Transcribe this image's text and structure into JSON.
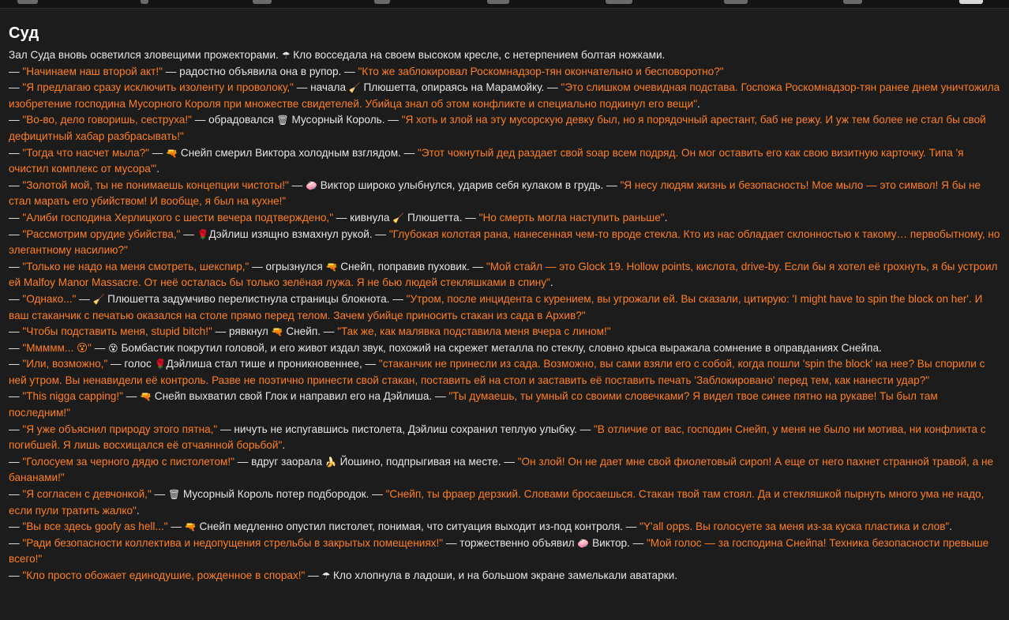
{
  "app": {
    "page_title": "Суд"
  },
  "nav": {
    "icons": [
      "home-icon",
      "pin-icon",
      "people-icon",
      "box-icon",
      "key-icon",
      "map-icon",
      "book-icon",
      "circle-icon",
      "window-icon"
    ]
  },
  "colors": {
    "background": "#1c1c1c",
    "text": "#e6e6e6",
    "quote": "#ff7f1e"
  },
  "story": [
    [
      {
        "t": "Зал Суда вновь осветился зловещими прожекторами. "
      },
      {
        "e": "☂"
      },
      {
        "t": " Кло восседала на своем высоком кресле, с нетерпением болтая ножками."
      }
    ],
    [
      {
        "t": "— "
      },
      {
        "q": "\"Начинаем наш второй акт!\""
      },
      {
        "t": " — радостно объявила она в рупор. — "
      },
      {
        "q": "\"Кто же заблокировал Роскомнадзор-тян окончательно и бесповоротно?\""
      }
    ],
    [
      {
        "t": "— "
      },
      {
        "q": "\"Я предлагаю сразу исключить изоленту и проволоку,\""
      },
      {
        "t": " — начала "
      },
      {
        "e": "🧹"
      },
      {
        "t": " Плюшетта, опираясь на Марамойку. — "
      },
      {
        "q": "\"Это слишком очевидная подстава. Госпожа Роскомнадзор-тян ранее днем уничтожила изобретение господина Мусорного Короля при множестве свидетелей. Убийца знал об этом конфликте и специально подкинул его вещи\""
      },
      {
        "t": "."
      }
    ],
    [
      {
        "t": "— "
      },
      {
        "q": "\"Во-во, дело говоришь, сеструха!\""
      },
      {
        "t": " — обрадовался "
      },
      {
        "e": "🗑"
      },
      {
        "t": " Мусорный Король. — "
      },
      {
        "q": "\"Я хоть и злой на эту мусорскую девку был, но я порядочный арестант, баб не режу. И уж тем более не стал бы свой дефицитный хабар разбрасывать!\""
      }
    ],
    [
      {
        "t": "— "
      },
      {
        "q": "\"Тогда что насчет мыла?\""
      },
      {
        "t": " — "
      },
      {
        "e": "🔫"
      },
      {
        "t": " Снейп смерил Виктора холодным взглядом. — "
      },
      {
        "q": "\"Этот чокнутый дед раздает свой soap всем подряд. Он мог оставить его как свою визитную карточку. Типа 'я очистил комплекс от мусора'\""
      },
      {
        "t": "."
      }
    ],
    [
      {
        "t": "— "
      },
      {
        "q": "\"Золотой мой, ты не понимаешь концепции чистоты!\""
      },
      {
        "t": " — "
      },
      {
        "e": "🧼"
      },
      {
        "t": " Виктор широко улыбнулся, ударив себя кулаком в грудь. — "
      },
      {
        "q": "\"Я несу людям жизнь и безопасность! Мое мыло — это символ! Я бы не стал марать его убийством! И вообще, я был на кухне!\""
      }
    ],
    [
      {
        "t": "— "
      },
      {
        "q": "\"Алиби господина Херлицкого с шести вечера подтверждено,\""
      },
      {
        "t": " — кивнула "
      },
      {
        "e": "🧹"
      },
      {
        "t": " Плюшетта. — "
      },
      {
        "q": "\"Но смерть могла наступить раньше\""
      },
      {
        "t": "."
      }
    ],
    [
      {
        "t": "— "
      },
      {
        "q": "\"Рассмотрим орудие убийства,\""
      },
      {
        "t": " — "
      },
      {
        "e": "🌹"
      },
      {
        "t": "Дэйлиш изящно взмахнул рукой. — "
      },
      {
        "q": "\"Глубокая колотая рана, нанесенная чем-то вроде стекла. Кто из нас обладает склонностью к такому… первобытному, но элегантному насилию?\""
      }
    ],
    [
      {
        "t": "— "
      },
      {
        "q": "\"Только не надо на меня смотреть, шекспир,\""
      },
      {
        "t": " — огрызнулся "
      },
      {
        "e": "🔫"
      },
      {
        "t": " Снейп, поправив пуховик. — "
      },
      {
        "q": "\"Мой стайл — это Glock 19. Hollow points, кислота, drive-by. Если бы я хотел её грохнуть, я бы устроил ей Malfoy Manor Massacre. От неё осталась бы только зелёная лужа. Я не бью людей стекляшками в спину\""
      },
      {
        "t": "."
      }
    ],
    [
      {
        "t": "— "
      },
      {
        "q": "\"Однако...\""
      },
      {
        "t": " — "
      },
      {
        "e": "🧹"
      },
      {
        "t": " Плюшетта задумчиво перелистнула страницы блокнота. — "
      },
      {
        "q": "\"Утром, после инцидента с курением, вы угрожали ей. Вы сказали, цитирую: 'I might have to spin the block on her'. И ваш стаканчик с печатью оказался на столе прямо перед телом. Зачем убийце приносить стакан из сада в Архив?\""
      }
    ],
    [
      {
        "t": "— "
      },
      {
        "q": "\"Чтобы подставить меня, stupid bitch!\""
      },
      {
        "t": " — рявкнул "
      },
      {
        "e": "🔫"
      },
      {
        "t": " Снейп. — "
      },
      {
        "q": "\"Так же, как малявка подставила меня вчера с лином!\""
      }
    ],
    [
      {
        "t": "— "
      },
      {
        "q": "\"Ммммм... 😵\""
      },
      {
        "t": " — "
      },
      {
        "e": "😵"
      },
      {
        "t": " Бомбастик покрутил головой, и его живот издал звук, похожий на скрежет металла по стеклу, словно крыса выражала сомнение в оправданиях Снейпа."
      }
    ],
    [
      {
        "t": "— "
      },
      {
        "q": "\"Или, возможно,\""
      },
      {
        "t": " — голос "
      },
      {
        "e": "🌹"
      },
      {
        "t": "Дэйлиша стал тише и проникновеннее, — "
      },
      {
        "q": "\"стаканчик не принесли из сада. Возможно, вы сами взяли его с собой, когда пошли 'spin the block' на нее? Вы спорили с ней утром. Вы ненавидели её контроль. Разве не поэтично принести свой стакан, поставить ей на стол и заставить её поставить печать 'Заблокировано' перед тем, как нанести удар?\""
      }
    ],
    [
      {
        "t": "— "
      },
      {
        "q": "\"This nigga capping!\""
      },
      {
        "t": " — "
      },
      {
        "e": "🔫"
      },
      {
        "t": " Снейп выхватил свой Глок и направил его на Дэйлиша. — "
      },
      {
        "q": "\"Ты думаешь, ты умный со своими словечками? Я видел твое синее пятно на рукаве! Ты был там последним!\""
      }
    ],
    [
      {
        "t": "— "
      },
      {
        "q": "\"Я уже объяснил природу этого пятна,\""
      },
      {
        "t": " — ничуть не испугавшись пистолета, Дэйлиш сохранил теплую улыбку. — "
      },
      {
        "q": "\"В отличие от вас, господин Снейп, у меня не было ни мотива, ни конфликта с погибшей. Я лишь восхищался её отчаянной борьбой\""
      },
      {
        "t": "."
      }
    ],
    [
      {
        "t": "— "
      },
      {
        "q": "\"Голосуем за черного дядю с пистолетом!\""
      },
      {
        "t": " — вдруг заорала "
      },
      {
        "e": "🍌"
      },
      {
        "t": " Йошино, подпрыгивая на месте. — "
      },
      {
        "q": "\"Он злой! Он не дает мне свой фиолетовый сироп! А еще от него пахнет странной травой, а не бананами!\""
      }
    ],
    [
      {
        "t": "— "
      },
      {
        "q": "\"Я согласен с девчонкой,\""
      },
      {
        "t": " — "
      },
      {
        "e": "🗑"
      },
      {
        "t": " Мусорный Король потер подбородок. — "
      },
      {
        "q": "\"Снейп, ты фраер дерзкий. Словами бросаешься. Стакан твой там стоял. Да и стекляшкой пырнуть много ума не надо, если пули тратить жалко\""
      },
      {
        "t": "."
      }
    ],
    [
      {
        "t": "— "
      },
      {
        "q": "\"Вы все здесь goofy as hell...\""
      },
      {
        "t": " — "
      },
      {
        "e": "🔫"
      },
      {
        "t": " Снейп медленно опустил пистолет, понимая, что ситуация выходит из-под контроля. — "
      },
      {
        "q": "\"Y'all opps. Вы голосуете за меня из-за куска пластика и слов\""
      },
      {
        "t": "."
      }
    ],
    [
      {
        "t": "— "
      },
      {
        "q": "\"Ради безопасности коллектива и недопущения стрельбы в закрытых помещениях!\""
      },
      {
        "t": " — торжественно объявил "
      },
      {
        "e": "🧼"
      },
      {
        "t": " Виктор. — "
      },
      {
        "q": "\"Мой голос — за господина Снейпа! Техника безопасности превыше всего!\""
      }
    ],
    [
      {
        "t": "— "
      },
      {
        "q": "\"Кло просто обожает единодушие, рожденное в спорах!\""
      },
      {
        "t": " — "
      },
      {
        "e": "☂"
      },
      {
        "t": " Кло хлопнула в ладоши, и на большом экране замелькали аватарки."
      }
    ]
  ]
}
